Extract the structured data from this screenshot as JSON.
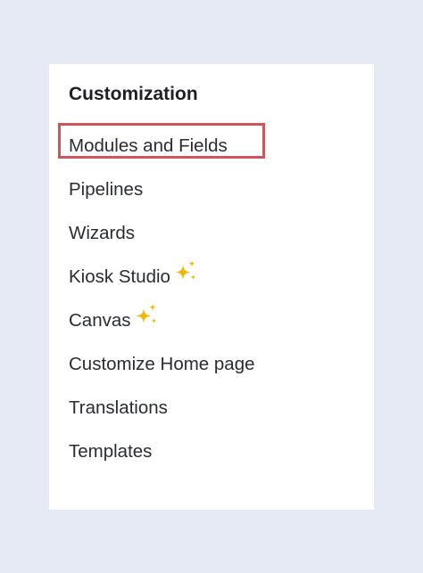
{
  "section": {
    "title": "Customization"
  },
  "menu": {
    "items": [
      {
        "label": "Modules and Fields",
        "selected": true,
        "icon": null
      },
      {
        "label": "Pipelines",
        "selected": false,
        "icon": null
      },
      {
        "label": "Wizards",
        "selected": false,
        "icon": null
      },
      {
        "label": "Kiosk Studio",
        "selected": false,
        "icon": "sparkle-icon"
      },
      {
        "label": "Canvas",
        "selected": false,
        "icon": "sparkle-icon"
      },
      {
        "label": "Customize Home page",
        "selected": false,
        "icon": null
      },
      {
        "label": "Translations",
        "selected": false,
        "icon": null
      },
      {
        "label": "Templates",
        "selected": false,
        "icon": null
      }
    ]
  },
  "colors": {
    "background": "#e6eaf4",
    "panel": "#ffffff",
    "text": "#2a2c33",
    "selection_border": "#d0555b",
    "sparkle": "#f2b705"
  }
}
